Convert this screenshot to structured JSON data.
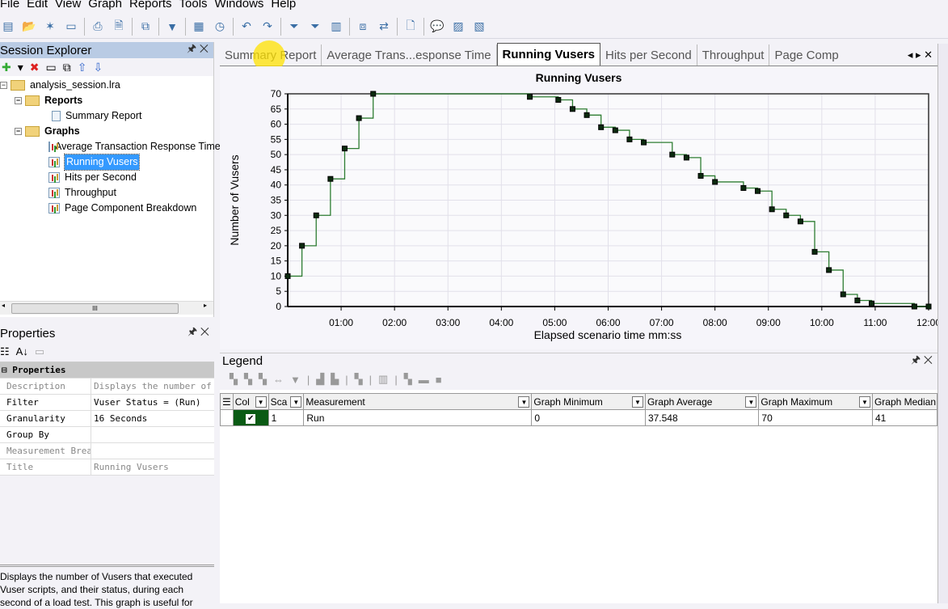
{
  "menu": [
    "File",
    "Edit",
    "View",
    "Graph",
    "Reports",
    "Tools",
    "Windows",
    "Help"
  ],
  "explorer": {
    "title": "Session Explorer",
    "root": "analysis_session.lra",
    "reports_label": "Reports",
    "reports": [
      "Summary Report"
    ],
    "graphs_label": "Graphs",
    "graphs": [
      "Average Transaction Response Time",
      "Running Vusers",
      "Hits per Second",
      "Throughput",
      "Page Component Breakdown"
    ],
    "selected": "Running Vusers",
    "scroll_thumb": "III"
  },
  "properties": {
    "title": "Properties",
    "section": "Properties",
    "rows": [
      {
        "key": "Description",
        "value": "Displays the number of Vusers",
        "grey": true
      },
      {
        "key": "Filter",
        "value": "Vuser Status = (Run)"
      },
      {
        "key": "Granularity",
        "value": "16 Seconds"
      },
      {
        "key": "Group By",
        "value": ""
      },
      {
        "key": "Measurement Breakdown",
        "value": "",
        "grey": true
      },
      {
        "key": "Title",
        "value": "Running Vusers",
        "grey": true
      }
    ],
    "description": "Displays the number of Vusers that executed Vuser scripts, and their status, during each second of a load test. This graph is useful for"
  },
  "tabs": [
    {
      "label": "Summary Report"
    },
    {
      "label": "Average Trans...esponse Time"
    },
    {
      "label": "Running Vusers",
      "active": true
    },
    {
      "label": "Hits per Second"
    },
    {
      "label": "Throughput"
    },
    {
      "label": "Page Comp"
    }
  ],
  "chart_data": {
    "type": "line",
    "step": true,
    "title": "Running Vusers",
    "xlabel": "Elapsed scenario time mm:ss",
    "ylabel": "Number of Vusers",
    "ylim": [
      0,
      70
    ],
    "yticks": [
      0,
      5,
      10,
      15,
      20,
      25,
      30,
      35,
      40,
      45,
      50,
      55,
      60,
      65,
      70
    ],
    "xlim": [
      "00:00",
      "12:00"
    ],
    "xticks": [
      "01:00",
      "02:00",
      "03:00",
      "04:00",
      "05:00",
      "06:00",
      "07:00",
      "08:00",
      "09:00",
      "10:00",
      "11:00",
      "12:00"
    ],
    "grid": true,
    "color": "#2e7d32",
    "series": [
      {
        "name": "Run",
        "x": [
          "00:00",
          "00:16",
          "00:32",
          "00:48",
          "01:04",
          "01:20",
          "01:36",
          "04:32",
          "05:04",
          "05:20",
          "05:36",
          "05:52",
          "06:08",
          "06:24",
          "06:40",
          "07:12",
          "07:28",
          "07:44",
          "08:00",
          "08:32",
          "08:48",
          "09:04",
          "09:20",
          "09:36",
          "09:52",
          "10:08",
          "10:24",
          "10:40",
          "10:56",
          "11:44",
          "12:00"
        ],
        "y": [
          10,
          20,
          30,
          42,
          52,
          62,
          70,
          69,
          68,
          65,
          63,
          59,
          58,
          55,
          54,
          50,
          49,
          43,
          41,
          39,
          38,
          32,
          30,
          28,
          18,
          12,
          4,
          2,
          1,
          0,
          0
        ]
      }
    ]
  },
  "legend": {
    "title": "Legend",
    "columns": [
      "Col",
      "Sca",
      "Measurement",
      "Graph Minimum",
      "Graph Average",
      "Graph Maximum",
      "Graph Median"
    ],
    "rows": [
      {
        "checked": true,
        "scale": "1",
        "measurement": "Run",
        "min": "0",
        "avg": "37.548",
        "max": "70",
        "median": "41"
      }
    ]
  }
}
